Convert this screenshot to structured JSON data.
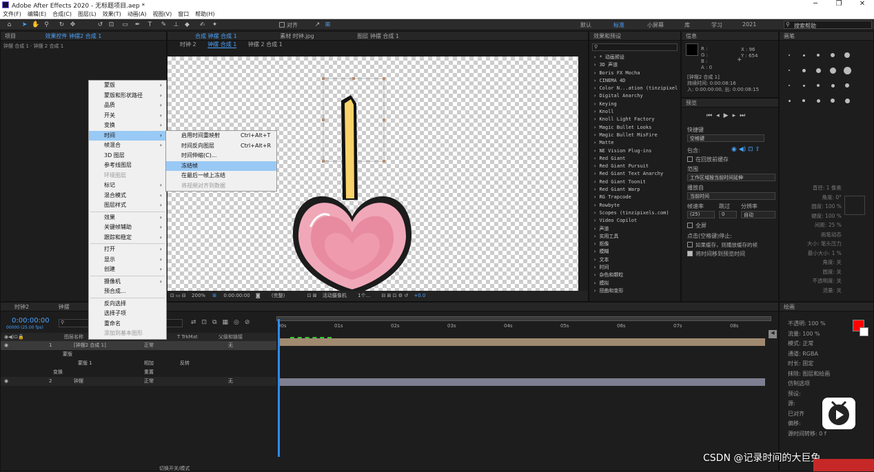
{
  "window": {
    "title": "Adobe After Effects 2020 - 无标题项目.aep *",
    "controls": [
      "─",
      "❐",
      "✕"
    ]
  },
  "menubar": [
    "文件(F)",
    "编辑(E)",
    "合成(C)",
    "图层(L)",
    "效果(T)",
    "动画(A)",
    "视图(V)",
    "窗口",
    "帮助(H)"
  ],
  "toolbar": {
    "align_label": "对齐",
    "workspaces": [
      "默认",
      "标准",
      "小屏幕",
      "库",
      "学习",
      "2021"
    ],
    "search_placeholder": "搜索帮助"
  },
  "left_panel": {
    "tabs": [
      "项目",
      "效果控件 钟摆2 合成 1"
    ],
    "breadcrumb": "钟摆 合成 1 · 钟摆 2 合成 1"
  },
  "comp_panel": {
    "tabs": [
      "合成 钟摆 合成 1",
      "素材 时钟.jpg",
      "图层 钟摆 合成 1"
    ],
    "subtabs": [
      "时钟 2",
      "钟摆 合成 1",
      "钟摆 2 合成 1"
    ],
    "footer": {
      "zoom": "200%",
      "time": "0:00:00:00",
      "quality": "(完整)",
      "camera": "活动摄像机",
      "views": "1个...",
      "exposure": "+0.0"
    }
  },
  "context_menu": {
    "items": [
      {
        "label": "蒙版",
        "arrow": true
      },
      {
        "label": "蒙版和形状路径",
        "arrow": true
      },
      {
        "label": "品质",
        "arrow": true
      },
      {
        "label": "开关",
        "arrow": true
      },
      {
        "label": "变换",
        "arrow": true
      },
      {
        "label": "时间",
        "arrow": true,
        "highlight": true
      },
      {
        "label": "帧混合",
        "arrow": true
      },
      {
        "label": "3D 图层"
      },
      {
        "label": "参考线图层"
      },
      {
        "label": "环境图层",
        "disabled": true
      },
      {
        "label": "标记",
        "arrow": true
      },
      {
        "label": "混合模式",
        "arrow": true
      },
      {
        "label": "图层样式",
        "arrow": true
      },
      {
        "sep": true
      },
      {
        "label": "效果",
        "arrow": true
      },
      {
        "label": "关键帧辅助",
        "arrow": true
      },
      {
        "label": "跟踪和稳定",
        "arrow": true
      },
      {
        "sep": true
      },
      {
        "label": "打开",
        "arrow": true
      },
      {
        "label": "显示",
        "arrow": true
      },
      {
        "label": "创建",
        "arrow": true
      },
      {
        "sep": true
      },
      {
        "label": "摄像机",
        "arrow": true
      },
      {
        "label": "预合成..."
      },
      {
        "sep": true
      },
      {
        "label": "反向选择"
      },
      {
        "label": "选择子项"
      },
      {
        "label": "重命名"
      },
      {
        "label": "添加到基本图形",
        "disabled": true
      }
    ]
  },
  "submenu": {
    "items": [
      {
        "label": "启用时间重映射",
        "shortcut": "Ctrl+Alt+T"
      },
      {
        "label": "时间反向图层",
        "shortcut": "Ctrl+Alt+R"
      },
      {
        "label": "时间伸缩(C)..."
      },
      {
        "label": "冻结帧",
        "highlight": true
      },
      {
        "label": "在最后一帧上冻结"
      },
      {
        "label": "将视频对齐到数据",
        "disabled": true
      }
    ]
  },
  "effects_panel": {
    "tab": "效果和预设",
    "items": [
      "* 动画预设",
      "3D 声道",
      "Boris FX Mocha",
      "CINEMA 4D",
      "Color N...ation (tinzipixel",
      "Digital Anarchy",
      "Keying",
      "Knoll",
      "Knoll Light Factory",
      "Magic Bullet Looks",
      "Magic Bullet MisFire",
      "Matte",
      "NE Vision Plug-ins",
      "Red Giant",
      "Red Giant Pursuit",
      "Red Giant Text Anarchy",
      "Red Giant Toonit",
      "Red Giant Warp",
      "RG Trapcode",
      "Rowbyte",
      "Scopes (tinzipixels.com)",
      "Video Copilot",
      "声道",
      "实用工具",
      "抠像",
      "模糊",
      "文本",
      "时间",
      "杂色和颗粒",
      "模拟",
      "扭曲和变形"
    ]
  },
  "info_panel": {
    "tab": "信息",
    "rgb": [
      "R :",
      "G :",
      "B :",
      "A : 0"
    ],
    "x": "X : 96",
    "y": "Y : 654",
    "layer": "[钟摆2 合成 1]",
    "duration": "持续时间: 0:00:08:16",
    "inout": "入: 0:00:00:00, 出: 0:00:08:15"
  },
  "preview_panel": {
    "tab": "预览",
    "shortcut_label": "快捷键",
    "shortcut_value": "空格键",
    "include_label": "包含:",
    "loop_label": "在回放前缓存",
    "range_label": "范围",
    "range_value": "工作区域按当前时间延伸",
    "playfrom_label": "播放自",
    "playfrom_value": "当前时间",
    "fps_label": "帧速率",
    "skip_label": "跳过",
    "res_label": "分辨率",
    "fps_value": "(25)",
    "skip_value": "0",
    "res_value": "自动",
    "fullscreen": "全屏",
    "stop_label": "点击(空格键)停止:",
    "cache_label": "如果缓存，则播放缓存的帧",
    "move_label": "将时间移到预览时间"
  },
  "brushes_panel": {
    "tab": "画笔",
    "labels": [
      "直径: 1 像素",
      "角度: 0°",
      "圆度: 100 %",
      "硬度: 100 %",
      "间距: 25 %",
      "画笔动态",
      "大小: 笔头压力",
      "最小大小: 1 %",
      "角度: 关",
      "圆度: 关",
      "不透明度: 关",
      "流量: 关"
    ]
  },
  "paint_panel": {
    "tab": "绘画",
    "labels": [
      "不透明: 100 %",
      "流量: 100 %",
      "模式: 正常",
      "通道: RGBA",
      "时长: 固定",
      "抹除: 图层和绘画",
      "仿制选项",
      "预设:",
      "源:",
      "已对齐",
      "偏移:",
      "源时间转移: 0 f"
    ]
  },
  "timeline": {
    "tabs": [
      "时钟2",
      "钟摆"
    ],
    "timecode": "0:00:00:00",
    "fps": "00000 (25.00 fps)",
    "col_layer": "图层名称",
    "col_trk": "T TrkMat",
    "col_parent": "父级和链接",
    "ruler": [
      "00s",
      "01s",
      "02s",
      "03s",
      "04s",
      "05s",
      "06s",
      "07s",
      "08s"
    ],
    "layers": [
      {
        "num": "1",
        "name": "[钟摆2 合成 1]",
        "mode": "正常",
        "parent": "无"
      },
      {
        "num": "",
        "name": "蒙版",
        "mode": "",
        "parent": ""
      },
      {
        "num": "",
        "name": "蒙版 1",
        "mode": "相加",
        "parent": "反转"
      },
      {
        "num": "",
        "name": "变换",
        "mode": "重置",
        "parent": ""
      },
      {
        "num": "2",
        "name": "钟摆",
        "mode": "正常",
        "parent": "无"
      }
    ],
    "footer": "切换开关/模式"
  },
  "watermark": "CSDN @记录时间的大巨兔",
  "colors": {
    "accent": "#2d8ceb",
    "fg_swatch": "#ff0000",
    "heart": "#e88ba0",
    "stick": "#f8d26a",
    "highlight": "#99c9f5"
  }
}
